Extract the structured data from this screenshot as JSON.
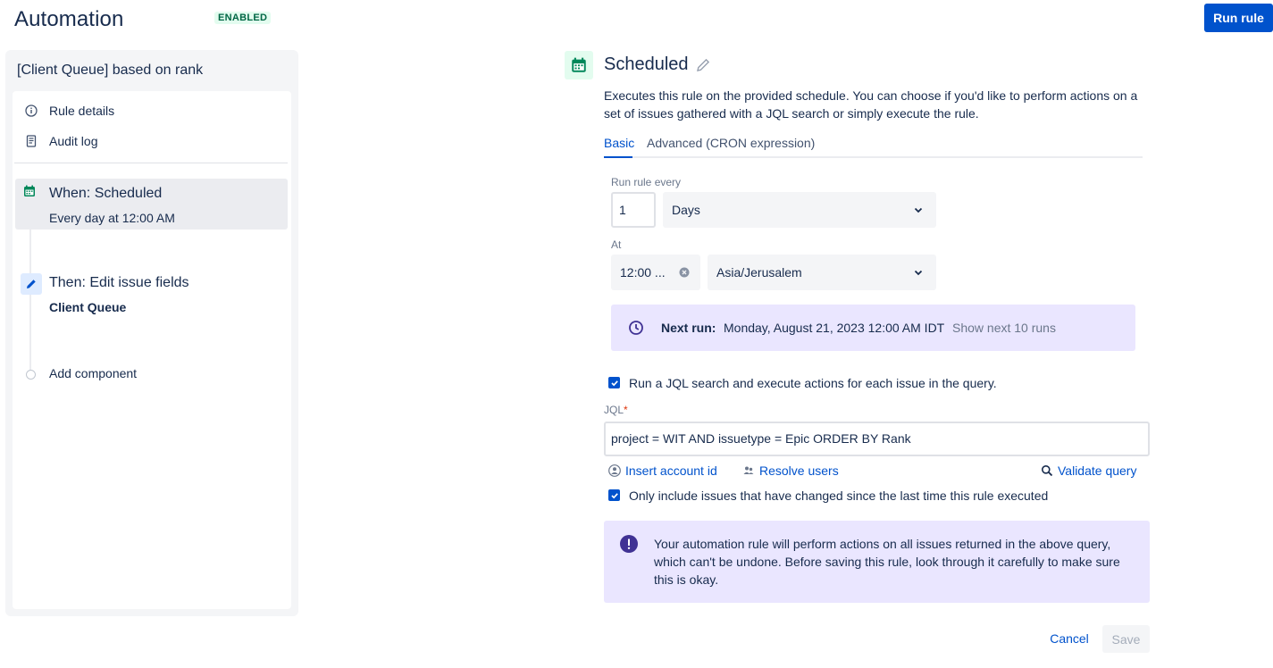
{
  "header": {
    "title": "Automation",
    "status": "ENABLED",
    "run_rule_label": "Run rule"
  },
  "sidebar": {
    "rule_name": "[Client Queue] based on rank",
    "links": [
      {
        "label": "Rule details",
        "icon": "info-icon"
      },
      {
        "label": "Audit log",
        "icon": "document-icon"
      }
    ],
    "trigger": {
      "title": "When: Scheduled",
      "subtitle": "Every day at 12:00 AM",
      "icon": "calendar-icon"
    },
    "action": {
      "title": "Then: Edit issue fields",
      "subtitle": "Client Queue",
      "icon": "pencil-icon"
    },
    "add_component_label": "Add component"
  },
  "main": {
    "title": "Scheduled",
    "description": "Executes this rule on the provided schedule. You can choose if you'd like to perform actions on a set of issues gathered with a JQL search or simply execute the rule.",
    "tabs": [
      {
        "label": "Basic",
        "active": true
      },
      {
        "label": "Advanced (CRON expression)",
        "active": false
      }
    ],
    "run_every_label": "Run rule every",
    "run_every_value": "1",
    "run_every_unit": "Days",
    "at_label": "At",
    "at_value": "12:00 ...",
    "timezone": "Asia/Jerusalem",
    "next_run": {
      "label": "Next run:",
      "value": "Monday, August 21, 2023 12:00 AM IDT",
      "link": "Show next 10 runs"
    },
    "jql_checkbox_label": "Run a JQL search and execute actions for each issue in the query.",
    "jql_label": "JQL",
    "jql_required": "*",
    "jql_value": "project = WIT AND issuetype = Epic ORDER BY Rank",
    "insert_account_label": "Insert account id",
    "resolve_users_label": "Resolve users",
    "validate_query_label": "Validate query",
    "changed_checkbox_label": "Only include issues that have changed since the last time this rule executed",
    "warning_text": "Your automation rule will perform actions on all issues returned in the above query, which can't be undone. Before saving this rule, look through it carefully to make sure this is okay.",
    "cancel_label": "Cancel",
    "save_label": "Save"
  },
  "colors": {
    "primary": "#0052cc",
    "enabled_bg": "#e3fcef",
    "enabled_text": "#006644",
    "info_panel_bg": "#eae6ff",
    "text": "#172b4d"
  }
}
